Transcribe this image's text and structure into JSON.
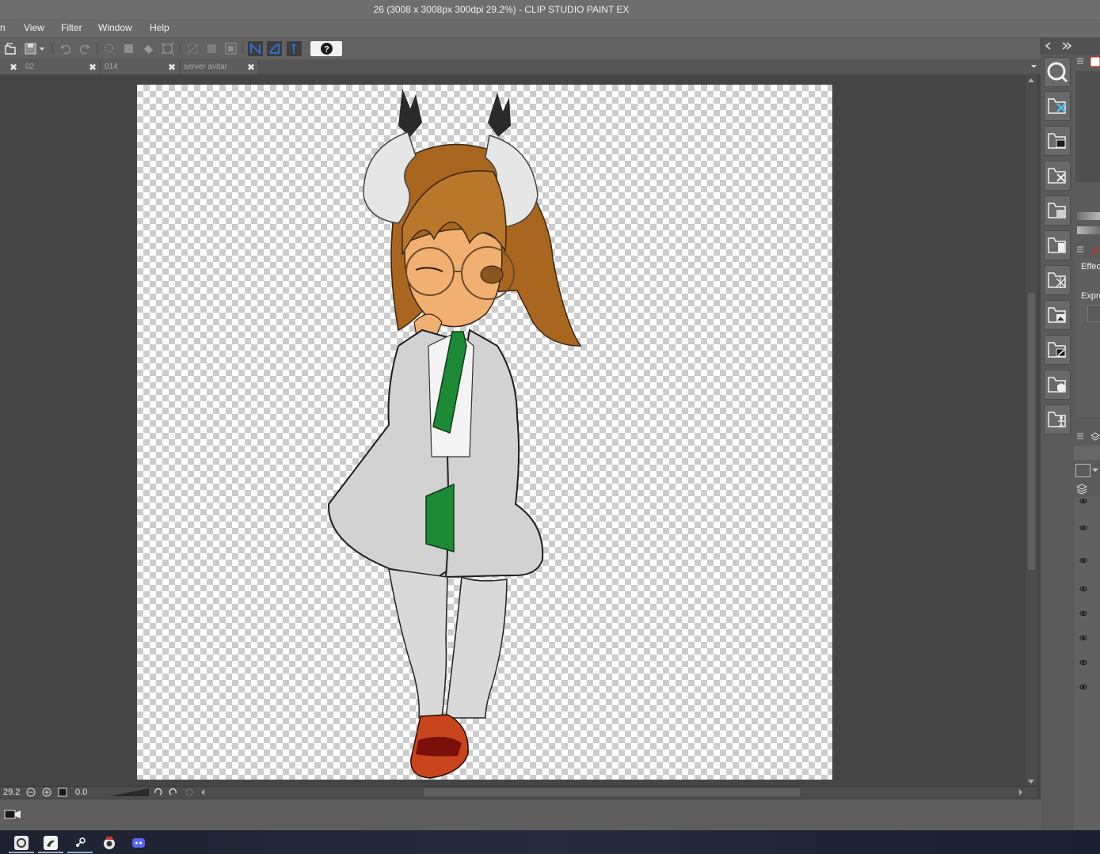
{
  "window": {
    "title": "26 (3008 x 3008px 300dpi 29.2%)  - CLIP STUDIO PAINT EX"
  },
  "menu": {
    "items": [
      {
        "label": "n"
      },
      {
        "label": "View"
      },
      {
        "label": "Filter"
      },
      {
        "label": "Window"
      },
      {
        "label": "Help"
      }
    ]
  },
  "toolbar": {
    "help_icon": "question-icon"
  },
  "tabs": [
    {
      "label": "02"
    },
    {
      "label": "014"
    },
    {
      "label": "server avitar"
    }
  ],
  "status": {
    "zoom": "29.2",
    "rotation": "0.0"
  },
  "right_panel": {
    "effect_label": "Effec",
    "expression_label": "Expre"
  },
  "colors": {
    "accent": "#2f6fd1",
    "background": "#454545",
    "canvas_check": "#cccccc"
  },
  "taskbar": {
    "icons": [
      "clip-studio-icon",
      "paint-app-icon",
      "steam-icon",
      "camera-app-icon",
      "discord-icon"
    ]
  }
}
